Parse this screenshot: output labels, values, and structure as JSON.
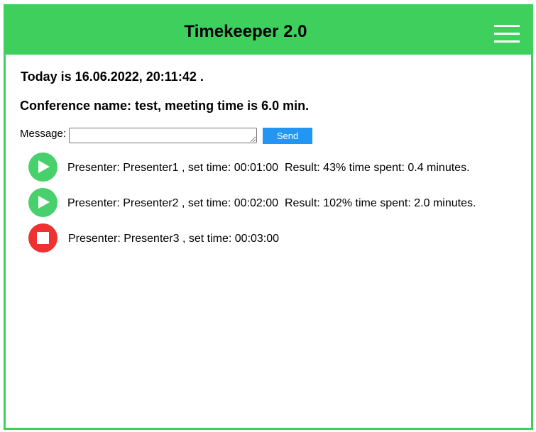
{
  "header": {
    "title": "Timekeeper 2.0",
    "menu_icon": "hamburger-menu-icon"
  },
  "colors": {
    "accent": "#3ecf5c",
    "play": "#47d06c",
    "stop": "#ef3131",
    "send_button": "#2196f3"
  },
  "today_text": "Today is 16.06.2022, 20:11:42 .",
  "conference_text": "Conference name: test, meeting time is 6.0 min.",
  "message": {
    "label": "Message:",
    "value": "",
    "send_label": "Send"
  },
  "presenters": [
    {
      "control": "play-icon",
      "text": "Presenter: Presenter1 , set time: 00:01:00  Result: 43% time spent: 0.4 minutes."
    },
    {
      "control": "play-icon",
      "text": "Presenter: Presenter2 , set time: 00:02:00  Result: 102% time spent: 2.0 minutes."
    },
    {
      "control": "stop-icon",
      "text": "Presenter: Presenter3 , set time: 00:03:00"
    }
  ]
}
